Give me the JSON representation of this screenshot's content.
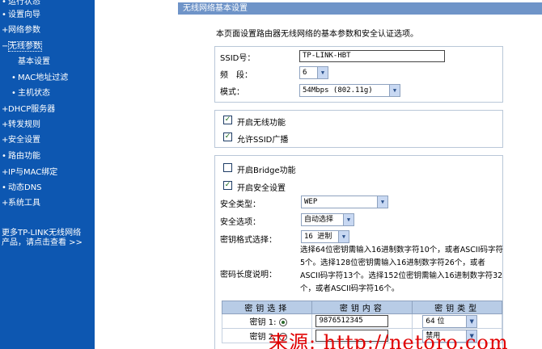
{
  "sidebar": {
    "items": [
      {
        "mark": "•",
        "label": "运行状态"
      },
      {
        "mark": "•",
        "label": "设置向导"
      },
      {
        "mark": "+",
        "label": "网络参数"
      },
      {
        "mark": "−",
        "label": "无线参数"
      },
      {
        "mark": "",
        "label": "基本设置"
      },
      {
        "mark": "•",
        "label": "MAC地址过滤"
      },
      {
        "mark": "•",
        "label": "主机状态"
      },
      {
        "mark": "+",
        "label": "DHCP服务器"
      },
      {
        "mark": "+",
        "label": "转发规则"
      },
      {
        "mark": "+",
        "label": "安全设置"
      },
      {
        "mark": "•",
        "label": "路由功能"
      },
      {
        "mark": "+",
        "label": "IP与MAC绑定"
      },
      {
        "mark": "•",
        "label": "动态DNS"
      },
      {
        "mark": "+",
        "label": "系统工具"
      }
    ],
    "more_line1": "更多TP-LINK无线网络",
    "more_line2": "产品，请点击查看 >>"
  },
  "main": {
    "title": "无线网络基本设置",
    "description": "本页面设置路由器无线网络的基本参数和安全认证选项。",
    "ssid_label": "SSID号：",
    "ssid_value": "TP-LINK-HBT",
    "channel_label": "频　段：",
    "channel_value": "6",
    "mode_label": "模式：",
    "mode_value": "54Mbps (802.11g)",
    "enable_wireless": "开启无线功能",
    "allow_ssid": "允许SSID广播",
    "enable_bridge": "开启Bridge功能",
    "enable_security": "开启安全设置",
    "sec_type_label": "安全类型：",
    "sec_type_value": "WEP",
    "sec_option_label": "安全选项：",
    "sec_option_value": "自动选择",
    "key_format_label": "密钥格式选择：",
    "key_format_value": "16 进制",
    "key_len_label": "密码长度说明：",
    "key_len_note": "选择64位密钥需输入16进制数字符10个，或者ASCII码字符5个。选择128位密钥需输入16进制数字符26个，或者ASCII码字符13个。选择152位密钥需输入16进制数字符32个，或者ASCII码字符16个。",
    "table": {
      "headers": [
        "密钥选择",
        "密钥内容",
        "密钥类型"
      ],
      "rows": [
        {
          "label": "密钥 1:",
          "value": "9876512345",
          "type": "64 位"
        },
        {
          "label": "密钥 2:",
          "value": "",
          "type": "禁用"
        }
      ]
    }
  },
  "watermark": "来源: http://netoro.com"
}
